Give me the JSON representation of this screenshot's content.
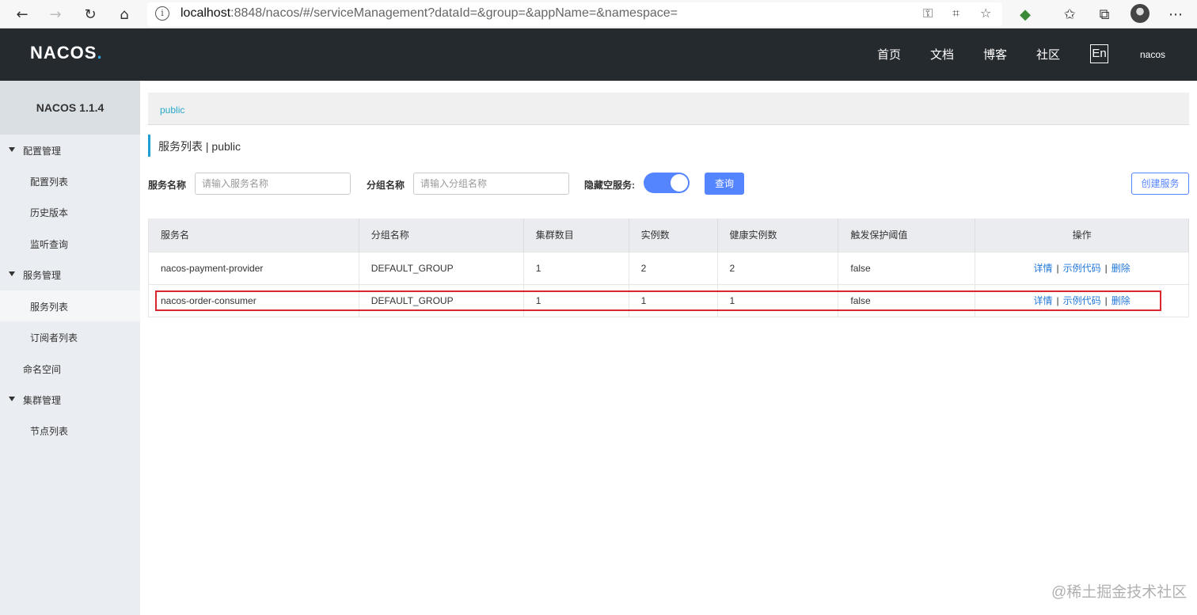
{
  "browser": {
    "url_host": "localhost",
    "url_rest": ":8848/nacos/#/serviceManagement?dataId=&group=&appName=&namespace="
  },
  "header": {
    "logo": "NACOS",
    "nav": [
      "首页",
      "文档",
      "博客",
      "社区"
    ],
    "lang": "En",
    "user": "nacos"
  },
  "sidebar": {
    "title": "NACOS 1.1.4",
    "groups": {
      "config": "配置管理",
      "service": "服务管理",
      "namespace": "命名空间",
      "cluster": "集群管理"
    },
    "items": {
      "config_list": "配置列表",
      "history": "历史版本",
      "listen": "监听查询",
      "service_list": "服务列表",
      "subscriber_list": "订阅者列表",
      "node_list": "节点列表"
    }
  },
  "breadcrumb": "public",
  "page_title": "服务列表  |  public",
  "filters": {
    "service_name_label": "服务名称",
    "service_name_placeholder": "请输入服务名称",
    "group_name_label": "分组名称",
    "group_name_placeholder": "请输入分组名称",
    "hide_empty_label": "隐藏空服务:",
    "hide_empty_on": true,
    "query_button": "查询",
    "create_button": "创建服务"
  },
  "table": {
    "headers": [
      "服务名",
      "分组名称",
      "集群数目",
      "实例数",
      "健康实例数",
      "触发保护阈值",
      "操作"
    ],
    "rows": [
      [
        "nacos-payment-provider",
        "DEFAULT_GROUP",
        "1",
        "2",
        "2",
        "false"
      ],
      [
        "nacos-order-consumer",
        "DEFAULT_GROUP",
        "1",
        "1",
        "1",
        "false"
      ]
    ],
    "actions": [
      "详情",
      "示例代码",
      "删除"
    ]
  },
  "watermark": "@稀土掘金技术社区"
}
